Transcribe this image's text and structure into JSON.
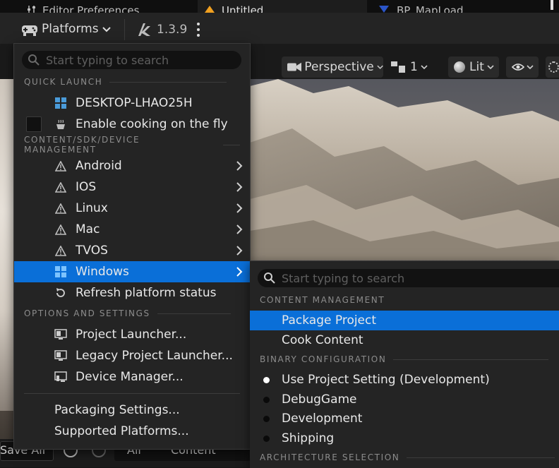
{
  "tabs": [
    {
      "label": "Editor Preferences",
      "icon": "sliders-icon"
    },
    {
      "label": "Untitled",
      "icon": "warning-icon"
    },
    {
      "label": "BP_MapLoad",
      "icon": "blueprint-icon"
    }
  ],
  "toolbar": {
    "platforms_label": "Platforms",
    "version_label": "1.3.9"
  },
  "viewport": {
    "perspective_label": "Perspective",
    "camera_speed_label": "1",
    "lit_label": "Lit"
  },
  "platforms_menu": {
    "search_placeholder": "Start typing to search",
    "sections": {
      "quick_launch": "QUICK LAUNCH",
      "content_sdk": "CONTENT/SDK/DEVICE MANAGEMENT",
      "options": "OPTIONS AND SETTINGS"
    },
    "quick_launch": {
      "device": "DESKTOP-LHAO25H",
      "cooking": "Enable cooking on the fly"
    },
    "platforms": [
      {
        "label": "Android",
        "icon": "warning-icon"
      },
      {
        "label": "IOS",
        "icon": "warning-icon"
      },
      {
        "label": "Linux",
        "icon": "warning-icon"
      },
      {
        "label": "Mac",
        "icon": "warning-icon"
      },
      {
        "label": "TVOS",
        "icon": "warning-icon"
      },
      {
        "label": "Windows",
        "icon": "windows-icon",
        "selected": true
      }
    ],
    "refresh": "Refresh platform status",
    "options": [
      {
        "label": "Project Launcher...",
        "icon": "launcher-icon"
      },
      {
        "label": "Legacy Project Launcher...",
        "icon": "launcher-icon"
      },
      {
        "label": "Device Manager...",
        "icon": "device-manager-icon"
      }
    ],
    "footer": [
      {
        "label": "Packaging Settings..."
      },
      {
        "label": "Supported Platforms..."
      }
    ]
  },
  "windows_submenu": {
    "search_placeholder": "Start typing to search",
    "sections": {
      "content_management": "CONTENT MANAGEMENT",
      "binary_configuration": "BINARY CONFIGURATION",
      "architecture": "ARCHITECTURE SELECTION"
    },
    "content_items": [
      {
        "label": "Package Project",
        "selected": true
      },
      {
        "label": "Cook Content"
      }
    ],
    "binary_items": [
      {
        "label": "Use Project Setting (Development)",
        "checked": true
      },
      {
        "label": "DebugGame"
      },
      {
        "label": "Development"
      },
      {
        "label": "Shipping"
      }
    ]
  },
  "bottom_bar": {
    "save_all": "Save All",
    "breadcrumb_all": "All",
    "breadcrumb_content": "Content"
  },
  "colors": {
    "accent": "#0a6fd8",
    "menu_bg": "#242424",
    "warning": "#f0a020"
  }
}
